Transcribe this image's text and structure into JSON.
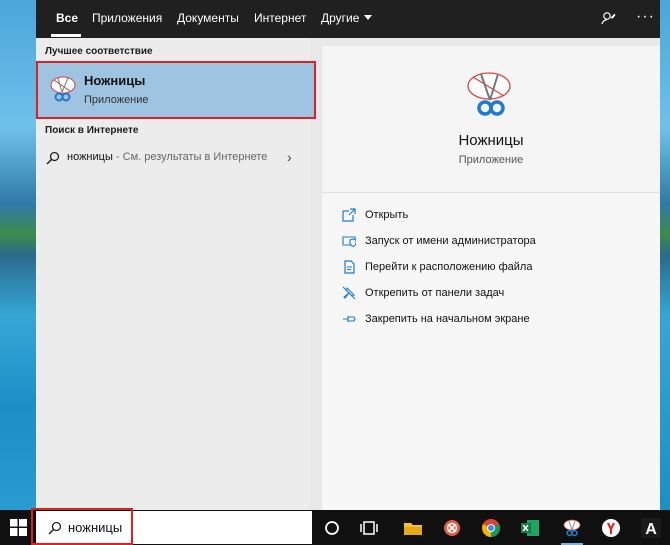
{
  "tabs": [
    {
      "label": "Все"
    },
    {
      "label": "Приложения"
    },
    {
      "label": "Документы"
    },
    {
      "label": "Интернет"
    },
    {
      "label": "Другие"
    }
  ],
  "left": {
    "best_match_title": "Лучшее соответствие",
    "best_match": {
      "name": "Ножницы",
      "type": "Приложение",
      "icon": "snipping-tool-icon"
    },
    "web_title": "Поиск в Интернете",
    "web_result": {
      "query": "ножницы",
      "hint": " - См. результаты в Интернете"
    }
  },
  "preview": {
    "name": "Ножницы",
    "type": "Приложение"
  },
  "actions": [
    {
      "label": "Открыть",
      "icon": "open-icon"
    },
    {
      "label": "Запуск от имени администратора",
      "icon": "admin-shield-icon"
    },
    {
      "label": "Перейти к расположению файла",
      "icon": "file-location-icon"
    },
    {
      "label": "Открепить от панели задач",
      "icon": "unpin-icon"
    },
    {
      "label": "Закрепить на начальном экране",
      "icon": "pin-icon"
    }
  ],
  "taskbar": {
    "search_value": "ножницы",
    "items": [
      "cortana-icon",
      "task-view-icon",
      "file-explorer-icon",
      "app-icon",
      "chrome-icon",
      "excel-icon",
      "snipping-tool-icon",
      "yandex-browser-icon",
      "font-app-icon"
    ],
    "font_app_label": "A"
  },
  "colors": {
    "accent": "#9fc4e2",
    "highlight_outline": "#dd2020",
    "tab_bar": "#202020",
    "taskbar": "#101010"
  }
}
